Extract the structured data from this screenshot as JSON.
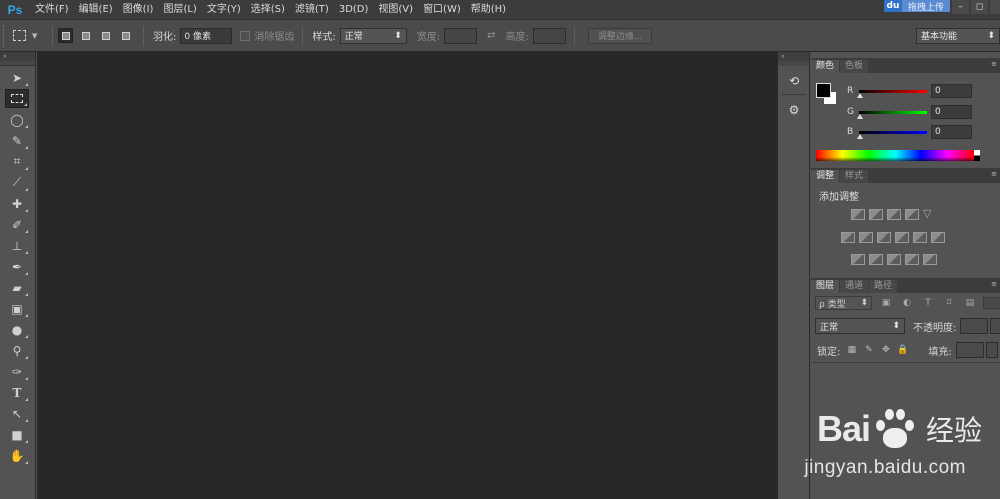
{
  "app": {
    "logo": "Ps"
  },
  "menu": [
    "文件(F)",
    "编辑(E)",
    "图像(I)",
    "图层(L)",
    "文字(Y)",
    "选择(S)",
    "滤镜(T)",
    "3D(D)",
    "视图(V)",
    "窗口(W)",
    "帮助(H)"
  ],
  "topbar": {
    "upload_label": "拖拽上传",
    "upload_badge": "du"
  },
  "options": {
    "feather_label": "羽化:",
    "feather_value": "0 像素",
    "antialias_label": "消除锯齿",
    "style_label": "样式:",
    "style_value": "正常",
    "width_label": "宽度:",
    "height_label": "高度:",
    "refine_edge_label": "调整边缘...",
    "workspace_value": "基本功能"
  },
  "color_panel": {
    "tabs": [
      "颜色",
      "色板"
    ],
    "channels": [
      {
        "name": "R",
        "value": "0",
        "color": "#ff2020"
      },
      {
        "name": "G",
        "value": "0",
        "color": "#20c020"
      },
      {
        "name": "B",
        "value": "0",
        "color": "#2030ff"
      }
    ],
    "foreground": "#000000",
    "background": "#ffffff"
  },
  "adjust_panel": {
    "tabs": [
      "调整",
      "样式"
    ],
    "title": "添加调整"
  },
  "layers_panel": {
    "tabs": [
      "图层",
      "通道",
      "路径"
    ],
    "filter_value": "ρ 类型",
    "blend_value": "正常",
    "opacity_label": "不透明度:",
    "lock_label": "锁定:",
    "fill_label": "填充:"
  },
  "watermark": {
    "brand": "Bai",
    "brand_tail": "经验",
    "url": "jingyan.baidu.com"
  }
}
